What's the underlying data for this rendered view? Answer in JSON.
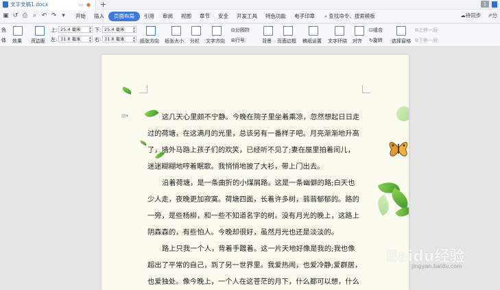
{
  "window": {
    "doc_tab_title": "文字文稿1.docx",
    "new_tab": "+",
    "badge_count": "1"
  },
  "menu": {
    "items": [
      "开始",
      "插入",
      "页面布局",
      "引用",
      "审阅",
      "视图",
      "章节",
      "安全",
      "开发工具",
      "特色功能",
      "电子印章"
    ],
    "active_index": 2,
    "search_placeholder": "查找命令、搜索模板",
    "sync_label": "待同步",
    "share_label": "分"
  },
  "ribbon": {
    "theme_color_label": "色",
    "font_label": "体",
    "effects_label": "效果",
    "margins_label": "页边距",
    "margin_top_label": "上:",
    "margin_top_value": "25.4 毫米",
    "margin_bottom_label": "下:",
    "margin_bottom_value": "25.4 毫米",
    "margin_left_label": "左:",
    "margin_left_value": "31.8 毫米",
    "margin_right_label": "右:",
    "margin_right_value": "31.8 毫米",
    "orientation_label": "纸张方向",
    "size_label": "纸张大小",
    "columns_label": "分栏",
    "text_direction_label": "文字方向",
    "breaks_label": "分隔符",
    "line_numbers_label": "行号",
    "background_label": "背景",
    "page_border_label": "页面边框",
    "grid_label": "稿纸设置",
    "wrap_label": "文字环绕",
    "align_label": "对齐",
    "group_label": "组合",
    "rotate_label": "旋转",
    "selection_pane_label": "选择窗格",
    "bring_forward_label": "上移一层",
    "send_backward_label": "下移一层"
  },
  "document": {
    "lines": [
      {
        "text": "这几天心里颇不宁静。今晚在院子里坐着乘凉，忽然想起日日走",
        "indent": true
      },
      {
        "text": "过的荷塘，在这满月的光里，总该另有一番样子吧。月亮渐渐地升高",
        "indent": false
      },
      {
        "text": "了，墙外马路上孩子们的欢笑，已经听不见了;妻在屋里拍着闰儿，",
        "indent": false
      },
      {
        "text": "迷迷糊糊地哼着眠歌。我悄悄地披了大衫，带上门出去。",
        "indent": false
      },
      {
        "text": "沿着荷塘，是一条曲折的小煤屑路。这是一条幽僻的路;白天也",
        "indent": true
      },
      {
        "text": "少人走，夜晚更加寂寞。荷塘四面，长着许多树，蓊蓊郁郁的。路的",
        "indent": false
      },
      {
        "text": "一旁，是些杨柳，和一些不知道名字的树。没有月光的晚上，这路上",
        "indent": false
      },
      {
        "text": "阴森森的，有些怕人。今晚却很好，虽然月光也还是淡淡的。",
        "indent": false
      },
      {
        "text": "路上只我一个人，背着手踱着。这一片天地好像是我的;我也像",
        "indent": true
      },
      {
        "text": "超出了平常的自己，到了另一世界里。我爱热闹，也爱冷静;爱群居，",
        "indent": false
      },
      {
        "text": "也爱独处。像今晚上，一个人在这苍茫的月下，什么都可以想，什么",
        "indent": false
      }
    ]
  },
  "watermark": {
    "brand": "Baidu经验",
    "url": "jingyan.baidu.com"
  },
  "colors": {
    "accent": "#3d7ae0",
    "page_background": "#fcfbf0"
  }
}
